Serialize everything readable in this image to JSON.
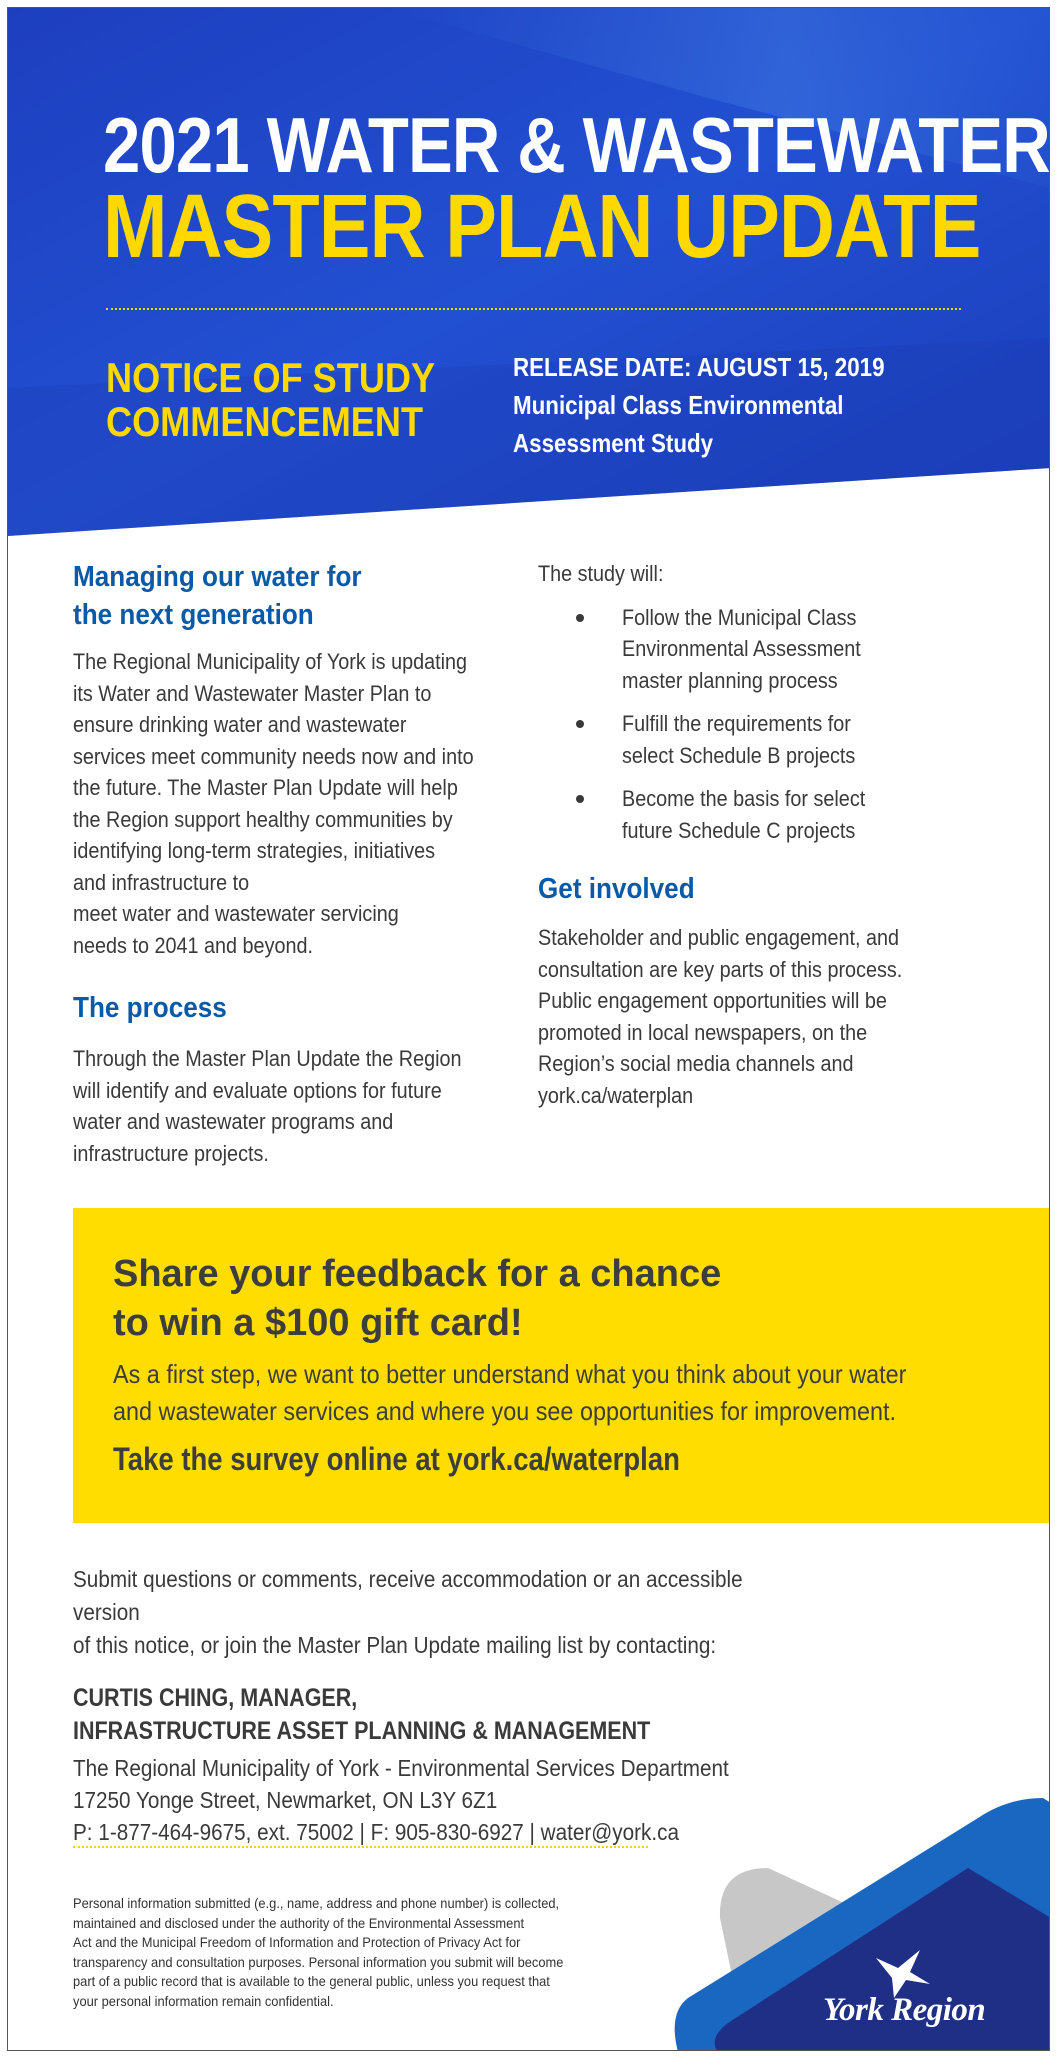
{
  "colors": {
    "header_blue": "#1d43c2",
    "accent_yellow": "#ffd800",
    "heading_blue": "#0b5aa8",
    "panel_yellow": "#ffdd00",
    "logo_navy": "#1f2f86",
    "logo_blue": "#1a67c2",
    "logo_gray": "#c7c7c7"
  },
  "header": {
    "title_line1": "2021 WATER & WASTEWATER",
    "title_line2": "MASTER PLAN UPDATE",
    "notice": "NOTICE OF STUDY\nCOMMENCEMENT",
    "release": "RELEASE DATE: AUGUST 15, 2019\nMunicipal Class Environmental\nAssessment Study"
  },
  "left": {
    "managing_heading": "Managing our water for\nthe next generation",
    "managing_body": "The Regional Municipality of York is updating\nits Water and Wastewater Master Plan to\nensure drinking water and wastewater\nservices meet community needs now and into\nthe future. The Master Plan Update will help\nthe Region support healthy communities by\nidentifying long-term strategies, initiatives\nand infrastructure to\nmeet water and wastewater servicing\nneeds to 2041 and beyond.",
    "process_heading": "The process",
    "process_body": "Through the Master Plan Update the Region\nwill identify and evaluate options for future\nwater and wastewater programs and\ninfrastructure projects."
  },
  "right": {
    "study_intro": "The study will:",
    "bullets": [
      "Follow the Municipal Class\nEnvironmental Assessment\nmaster planning process",
      "Fulfill the requirements for\nselect Schedule B projects",
      "Become the basis for select\nfuture Schedule C projects"
    ],
    "involved_heading": "Get involved",
    "involved_body": "Stakeholder and public engagement, and\nconsultation are key parts of this process.\nPublic engagement opportunities will be\npromoted in local newspapers, on the\nRegion’s social media channels and\nyork.ca/waterplan"
  },
  "feedback": {
    "headline": "Share your feedback for a chance\nto win a $100 gift card!",
    "body": "As a first step, we want to better understand what you think about your water\nand wastewater services and where you see opportunities for improvement.",
    "survey": "Take the survey online at york.ca/waterplan"
  },
  "contact": {
    "intro": "Submit questions or comments, receive accommodation or an accessible version\nof this notice, or join the Master Plan Update mailing list by contacting:",
    "name": "CURTIS CHING, MANAGER,\nINFRASTRUCTURE ASSET PLANNING & MANAGEMENT",
    "address": "The Regional Municipality of York - Environmental Services Department\n17250 Yonge Street, Newmarket, ON  L3Y 6Z1\nP: 1-877-464-9675, ext. 75002  |  F: 905-830-6927  |  water@york.ca"
  },
  "privacy": "Personal information submitted (e.g., name, address and phone number) is collected,\nmaintained and disclosed under the authority of the Environmental Assessment\nAct and the Municipal Freedom of Information and Protection of Privacy Act for\ntransparency and consultation purposes. Personal information you submit will become\npart of a public record that is available to the general public, unless you request that\nyour personal information remain confidential.",
  "logo": {
    "text": "York Region"
  }
}
